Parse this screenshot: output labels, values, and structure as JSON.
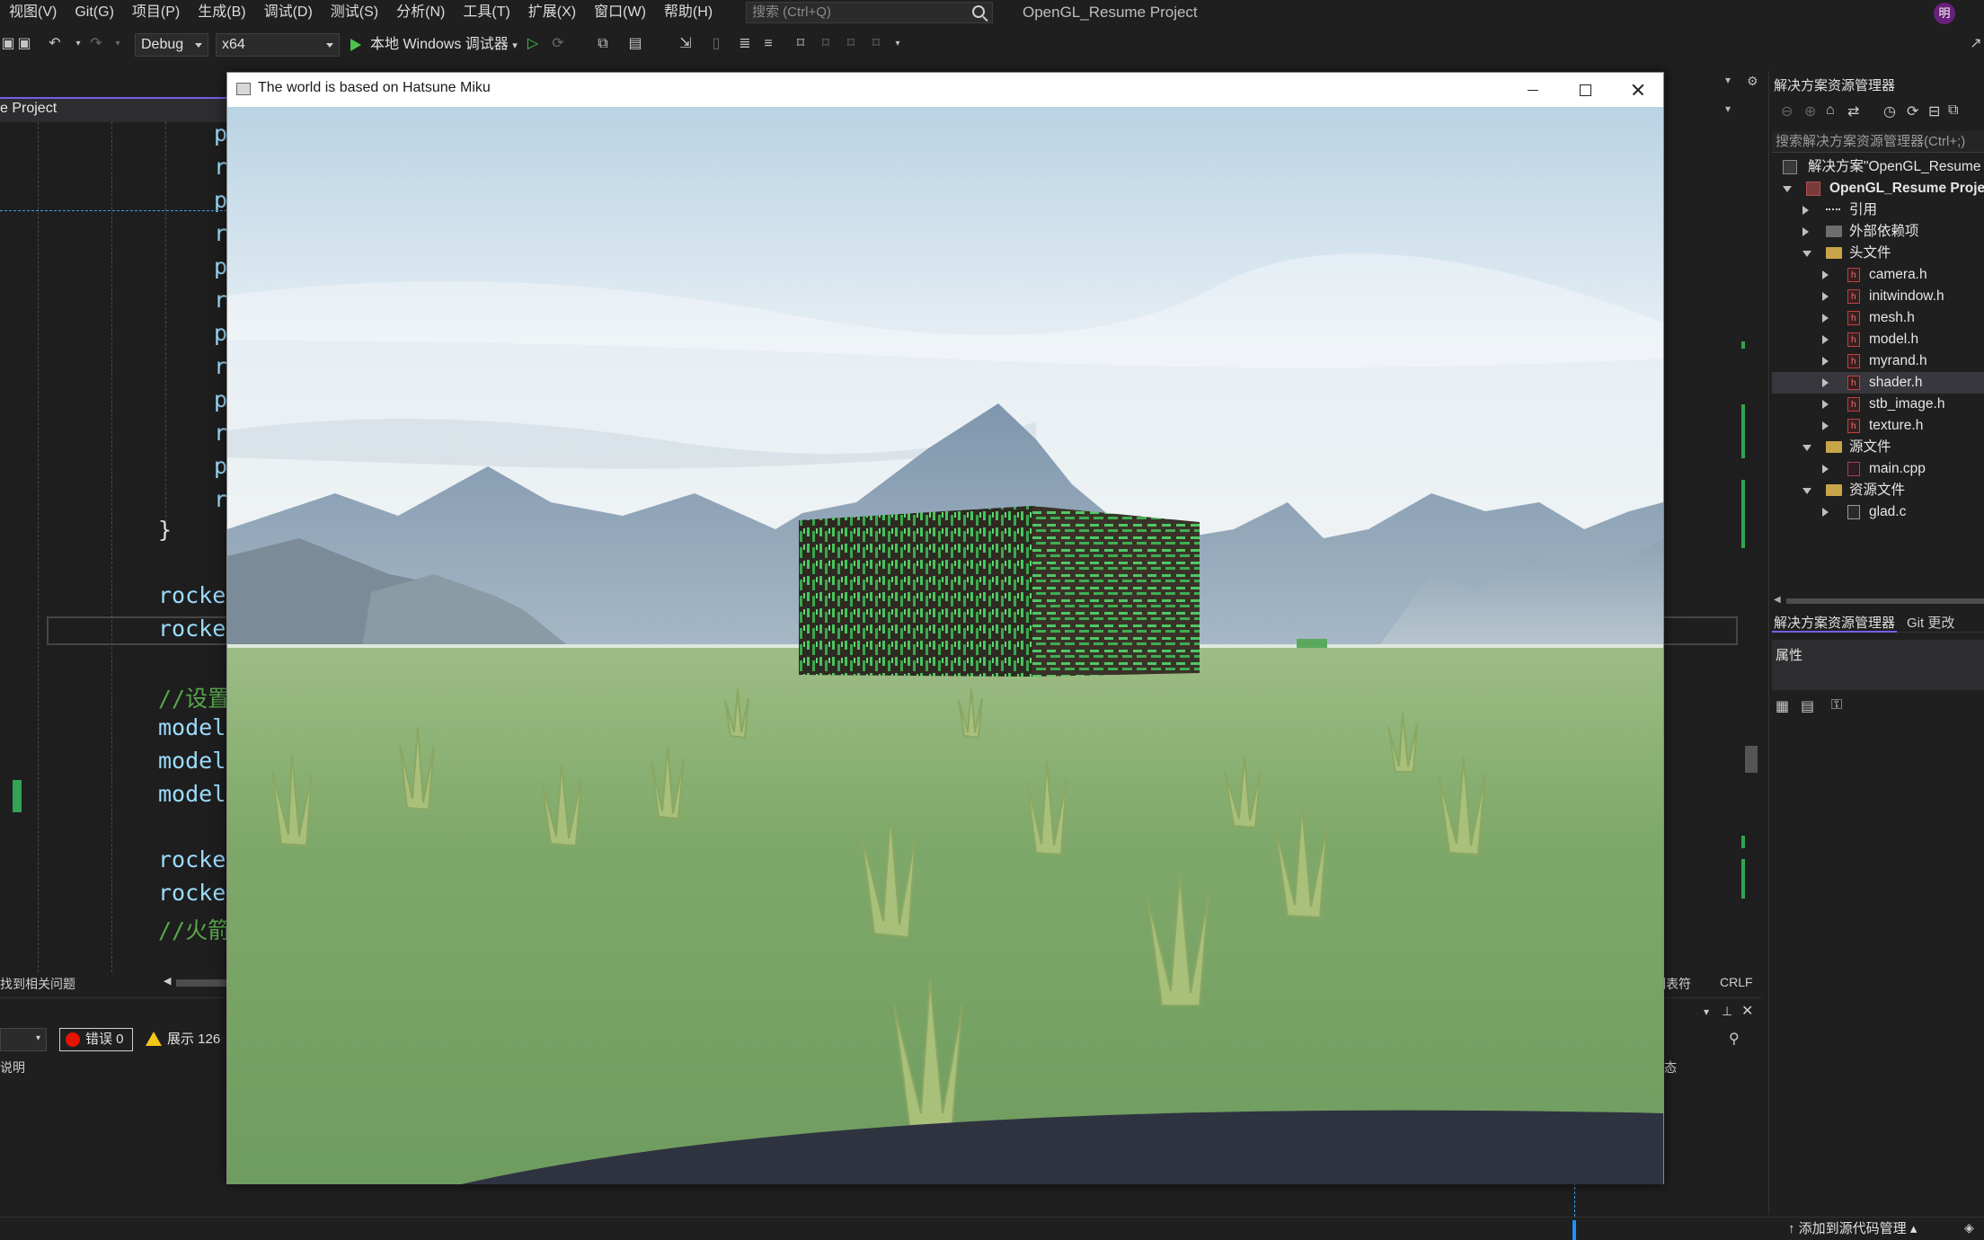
{
  "menubar": {
    "items": [
      "视图(V)",
      "Git(G)",
      "项目(P)",
      "生成(B)",
      "调试(D)",
      "测试(S)",
      "分析(N)",
      "工具(T)",
      "扩展(X)",
      "窗口(W)",
      "帮助(H)"
    ],
    "search_placeholder": "搜索 (Ctrl+Q)",
    "app_title": "OpenGL_Resume Project",
    "avatar_initial": "明"
  },
  "toolbar": {
    "config": "Debug",
    "platform": "x64",
    "run_label": "本地 Windows 调试器"
  },
  "editor": {
    "tab_title": "e Project",
    "code_lines": [
      "p",
      "r",
      "p",
      "r",
      "p",
      "r",
      "p",
      "r",
      "p",
      "r",
      "p",
      "r"
    ],
    "closing_brace": "}",
    "line_rocke_1": "rocke",
    "line_rocke_2": "rocke",
    "comment_set": "//设置",
    "line_model_1": "model",
    "line_model_2": "model",
    "line_model_3": "model",
    "line_rocke_3": "rocke",
    "line_rocke_4": "rocke",
    "comment_rocket": "//火箭",
    "status_left": "找到相关问题",
    "status_right_1": "制表符",
    "status_right_2": "CRLF"
  },
  "errorlist": {
    "errors_label": "错误 0",
    "warnings_label": "展示 126",
    "column_desc": "说明",
    "column_state": "态"
  },
  "solution_explorer": {
    "title": "解决方案资源管理器",
    "search_placeholder": "搜索解决方案资源管理器(Ctrl+;)",
    "solution_label": "解决方案\"OpenGL_Resume",
    "project_label": "OpenGL_Resume Proje",
    "references": "引用",
    "external_deps": "外部依赖项",
    "headers_folder": "头文件",
    "headers": [
      "camera.h",
      "initwindow.h",
      "mesh.h",
      "model.h",
      "myrand.h",
      "shader.h",
      "stb_image.h",
      "texture.h"
    ],
    "sources_folder": "源文件",
    "sources": [
      "main.cpp"
    ],
    "resources_folder": "资源文件",
    "resources": [
      "glad.c"
    ],
    "tab_active": "解决方案资源管理器",
    "tab_git": "Git 更改",
    "properties_title": "属性"
  },
  "statusbar": {
    "add_source": "添加到源代码管理"
  },
  "gl_window": {
    "title": "The world is based on Hatsune Miku"
  },
  "colors": {
    "accent": "#7160e8",
    "selection_blue": "#1e90ff",
    "error_red": "#e51400",
    "warning_yellow": "#f5c518"
  }
}
